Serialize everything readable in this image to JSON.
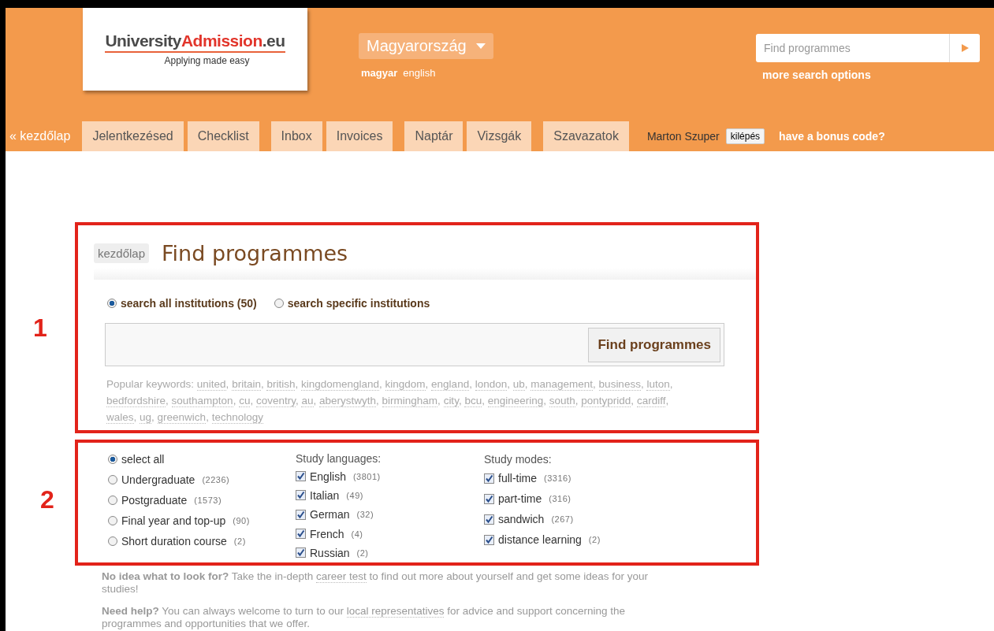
{
  "header": {
    "logo": {
      "name": "University**Admission**.eu",
      "tagline": "Applying made easy"
    },
    "country": {
      "label": "Magyarország"
    },
    "languages": [
      {
        "label": "magyar",
        "selected": true
      },
      {
        "label": "english",
        "selected": false
      }
    ],
    "search": {
      "placeholder": "Find programmes",
      "more": "more search options"
    },
    "nav": {
      "home": "« kezdőlap",
      "groups": [
        [
          "Jelentkezésed",
          "Checklist"
        ],
        [
          "Inbox",
          "Invoices"
        ],
        [
          "Naptár",
          "Vizsgák"
        ],
        [
          "Szavazatok"
        ]
      ],
      "user": "Marton Szuper",
      "logout": "kilépés",
      "bonus": "have a bonus code?"
    }
  },
  "annotations": [
    "1",
    "2"
  ],
  "search_panel": {
    "breadcrumb": "kezdőlap",
    "title": "Find programmes",
    "scope": [
      {
        "label": "search all institutions (50)",
        "selected": true
      },
      {
        "label": "search specific institutions",
        "selected": false
      }
    ],
    "button": "Find programmes",
    "keywords_label": "Popular keywords:",
    "keyword_separator": ",",
    "keywords": [
      "united",
      "britain",
      "british",
      "kingdomengland",
      "kingdom",
      "england",
      "london",
      "ub",
      "management",
      "business",
      "luton",
      "bedfordshire",
      "southampton",
      "cu",
      "coventry",
      "au",
      "aberystwyth",
      "birmingham",
      "city",
      "bcu",
      "engineering",
      "south",
      "pontypridd",
      "cardiff",
      "wales",
      "ug",
      "greenwich",
      "technology"
    ]
  },
  "filters": {
    "levels": [
      {
        "label": "select all",
        "selected": true
      },
      {
        "label": "Undergraduate",
        "count": "(2236)",
        "selected": false
      },
      {
        "label": "Postgraduate",
        "count": "(1573)",
        "selected": false
      },
      {
        "label": "Final year and top-up",
        "count": "(90)",
        "selected": false
      },
      {
        "label": "Short duration course",
        "count": "(2)",
        "selected": false
      }
    ],
    "languages_title": "Study languages:",
    "languages": [
      {
        "label": "English",
        "count": "(3801)",
        "checked": true
      },
      {
        "label": "Italian",
        "count": "(49)",
        "checked": true
      },
      {
        "label": "German",
        "count": "(32)",
        "checked": true
      },
      {
        "label": "French",
        "count": "(4)",
        "checked": true
      },
      {
        "label": "Russian",
        "count": "(2)",
        "checked": true
      }
    ],
    "modes_title": "Study modes:",
    "modes": [
      {
        "label": "full-time",
        "count": "(3316)",
        "checked": true
      },
      {
        "label": "part-time",
        "count": "(316)",
        "checked": true
      },
      {
        "label": "sandwich",
        "count": "(267)",
        "checked": true
      },
      {
        "label": "distance learning",
        "count": "(2)",
        "checked": true
      }
    ]
  },
  "help": [
    {
      "lead": "No idea what to look for?",
      "before": "Take the in-depth",
      "link": "career test",
      "after": "to find out more about yourself and get some ideas for your studies!"
    },
    {
      "lead": "Need help?",
      "before": "You can always welcome to turn to our",
      "link": "local representatives",
      "after": "for advice and support concerning the programmes and opportunities that we offer."
    }
  ]
}
